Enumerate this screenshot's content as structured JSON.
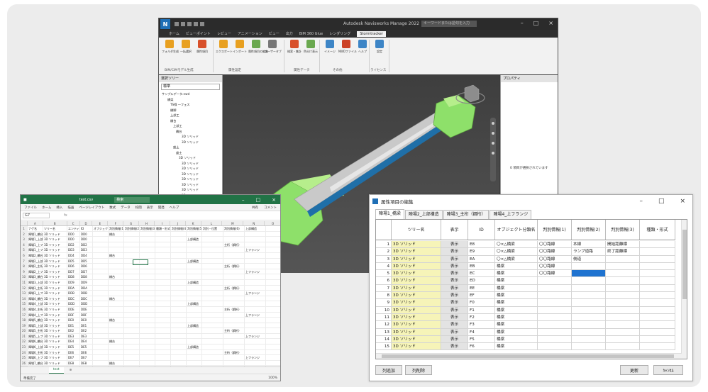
{
  "navisworks": {
    "app_title": "Autodesk Navisworks Manage 2022",
    "search_placeholder": "キーワードまたは語句を入力",
    "ribbon_tabs": [
      "ホーム",
      "ビューポイント",
      "レビュー",
      "アニメーション",
      "ビュー",
      "出力",
      "BIM 360 Glue",
      "レンダリング",
      "Stormtracker"
    ],
    "active_tab": "Stormtracker",
    "ribbon_buttons": [
      {
        "label": "フォルダ生成",
        "color": "#e8a020"
      },
      {
        "label": "一括選択",
        "color": "#e8a020"
      },
      {
        "label": "属性項目",
        "color": "#d8502a"
      },
      {
        "label": "エクスポート",
        "color": "#e8a020"
      },
      {
        "label": "インポート",
        "color": "#e8a020"
      },
      {
        "label": "属性項目の編集",
        "color": "#6aa84f"
      },
      {
        "label": "ユーザータブ",
        "color": "#777777"
      },
      {
        "label": "検索・集計",
        "color": "#d8502a"
      },
      {
        "label": "色分け表示",
        "color": "#6aa84f"
      },
      {
        "label": "イメージ",
        "color": "#3d85c6"
      },
      {
        "label": "NWDファイル",
        "color": "#cc4125"
      },
      {
        "label": "ヘルプ",
        "color": "#3d85c6"
      },
      {
        "label": "設定",
        "color": "#3d85c6"
      }
    ],
    "ribbon_groups": [
      "BIM/CIMモデル生成",
      "属性設定",
      "属性データ",
      "その他",
      "ライセンス"
    ],
    "tree_panel_title": "選択ツリー",
    "tree_combo": "標準",
    "tree_items": [
      "サンプルデータ.nwd",
      "橋梁",
      "TS線 一フェス",
      "橋脚",
      "上部工",
      "橋台",
      "上部工",
      "橋台",
      "3D ソリッド",
      "3D ソリッド",
      "盛土",
      "盛土",
      "3D ソリッド",
      "3D ソリッド",
      "3D ソリッド",
      "3D ソリッド",
      "3D ソリッド",
      "3D ソリッド",
      "3D ソリッド",
      "3D ソリッド",
      "3D ソリッド",
      "3D ソリッド",
      "3D ソリッド",
      "3D ソリッド",
      "3D ソリッド",
      "3D ソリッド"
    ],
    "properties_title": "プロパティ",
    "properties_empty": "0 項目が選択されています"
  },
  "excel": {
    "filename": "test.csv",
    "search_placeholder": "検索",
    "tabs": [
      "ファイル",
      "ホーム",
      "挿入",
      "描画",
      "ページレイアウト",
      "数式",
      "データ",
      "校閲",
      "表示",
      "開発",
      "ヘルプ"
    ],
    "share_label": "共有",
    "comment_label": "コメント",
    "name_box": "G7",
    "columns": [
      "A",
      "B",
      "C",
      "D",
      "E",
      "F",
      "G",
      "H",
      "I",
      "J",
      "K",
      "L",
      "M",
      "N",
      "O"
    ],
    "header_row": [
      "ナゲ名",
      "ツリー名",
      "エンティティ",
      "ID",
      "オブジェクト分類名",
      "判別情報(1)",
      "判別情報(2)",
      "判別情報(3)",
      "種類・形式",
      "判別情報(4)",
      "判別情報(5)",
      "判別・位置",
      "判別情報(6)",
      "上部構造"
    ],
    "rows": [
      [
        "陣場1_橋台",
        "3D ソリッド",
        "DD0",
        "DD0",
        "",
        "橋台",
        "",
        "",
        "",
        "",
        "",
        "",
        "",
        ""
      ],
      [
        "陣場1_上部工",
        "3D ソリッド",
        "DD0",
        "DD0",
        "",
        "",
        "",
        "",
        "",
        "",
        "上部構造",
        "",
        "",
        ""
      ],
      [
        "陣場1_上フランジ",
        "3D ソリッド",
        "DD2",
        "DD2",
        "",
        "",
        "",
        "",
        "",
        "",
        "",
        "",
        "主桁（鋼桁）",
        ""
      ],
      [
        "陣場1_上フランジ",
        "3D ソリッド",
        "DD3",
        "DD3",
        "",
        "",
        "",
        "",
        "",
        "",
        "",
        "",
        "",
        "上フランジ"
      ],
      [
        "陣場2_橋台",
        "3D ソリッド",
        "DD4",
        "DD4",
        "",
        "橋台",
        "",
        "",
        "",
        "",
        "",
        "",
        "",
        ""
      ],
      [
        "陣場2_上部工",
        "3D ソリッド",
        "DD5",
        "DD5",
        "",
        "",
        "",
        "",
        "",
        "",
        "上部構造",
        "",
        "",
        ""
      ],
      [
        "陣場2_主桁",
        "3D ソリッド",
        "DD6",
        "DD6",
        "",
        "",
        "",
        "",
        "",
        "",
        "",
        "",
        "主桁（鋼桁）",
        ""
      ],
      [
        "陣場2_上フランジ",
        "3D ソリッド",
        "DD7",
        "DD7",
        "",
        "",
        "",
        "",
        "",
        "",
        "",
        "",
        "",
        "上フランジ"
      ],
      [
        "陣場3_橋台",
        "3D ソリッド",
        "DD8",
        "DD8",
        "",
        "橋台",
        "",
        "",
        "",
        "",
        "",
        "",
        "",
        ""
      ],
      [
        "陣場3_上部工",
        "3D ソリッド",
        "DD9",
        "DD9",
        "",
        "",
        "",
        "",
        "",
        "",
        "上部構造",
        "",
        "",
        ""
      ],
      [
        "陣場3_主桁",
        "3D ソリッド",
        "DDA",
        "DDA",
        "",
        "",
        "",
        "",
        "",
        "",
        "",
        "",
        "主桁（鋼桁）",
        ""
      ],
      [
        "陣場3_上フランジ",
        "3D ソリッド",
        "DDB",
        "DDB",
        "",
        "",
        "",
        "",
        "",
        "",
        "",
        "",
        "",
        "上フランジ"
      ],
      [
        "陣場4_橋台",
        "3D ソリッド",
        "DDC",
        "DDC",
        "",
        "橋台",
        "",
        "",
        "",
        "",
        "",
        "",
        "",
        ""
      ],
      [
        "陣場4_上部工",
        "3D ソリッド",
        "DDD",
        "DDD",
        "",
        "",
        "",
        "",
        "",
        "",
        "上部構造",
        "",
        "",
        ""
      ],
      [
        "陣場4_主桁",
        "3D ソリッド",
        "DDE",
        "DDE",
        "",
        "",
        "",
        "",
        "",
        "",
        "",
        "",
        "主桁（鋼桁）",
        ""
      ],
      [
        "陣場4_上フランジ",
        "3D ソリッド",
        "DDF",
        "DDF",
        "",
        "",
        "",
        "",
        "",
        "",
        "",
        "",
        "",
        "上フランジ"
      ],
      [
        "陣場5_橋台",
        "3D ソリッド",
        "DE0",
        "DE0",
        "",
        "橋台",
        "",
        "",
        "",
        "",
        "",
        "",
        "",
        ""
      ],
      [
        "陣場5_上部工",
        "3D ソリッド",
        "DE1",
        "DE1",
        "",
        "",
        "",
        "",
        "",
        "",
        "上部構造",
        "",
        "",
        ""
      ],
      [
        "陣場5_主桁",
        "3D ソリッド",
        "DE2",
        "DE2",
        "",
        "",
        "",
        "",
        "",
        "",
        "",
        "",
        "主桁（鋼桁）",
        ""
      ],
      [
        "陣場5_上フランジ",
        "3D ソリッド",
        "DE3",
        "DE3",
        "",
        "",
        "",
        "",
        "",
        "",
        "",
        "",
        "",
        "上フランジ"
      ],
      [
        "陣場6_橋台",
        "3D ソリッド",
        "DE4",
        "DE4",
        "",
        "橋台",
        "",
        "",
        "",
        "",
        "",
        "",
        "",
        ""
      ],
      [
        "陣場6_上部工",
        "3D ソリッド",
        "DE5",
        "DE5",
        "",
        "",
        "",
        "",
        "",
        "",
        "上部構造",
        "",
        "",
        ""
      ],
      [
        "陣場6_主桁",
        "3D ソリッド",
        "DE6",
        "DE6",
        "",
        "",
        "",
        "",
        "",
        "",
        "",
        "",
        "主桁（鋼桁）",
        ""
      ],
      [
        "陣場6_上フランジ",
        "3D ソリッド",
        "DE7",
        "DE7",
        "",
        "",
        "",
        "",
        "",
        "",
        "",
        "",
        "",
        "上フランジ"
      ],
      [
        "陣場7_橋台",
        "3D ソリッド",
        "DE8",
        "DE8",
        "",
        "橋台",
        "",
        "",
        "",
        "",
        "",
        "",
        "",
        ""
      ],
      [
        "陣場7_上部工",
        "3D ソリッド",
        "DE9",
        "DE9",
        "",
        "",
        "",
        "",
        "",
        "",
        "上部構造",
        "",
        "",
        ""
      ],
      [
        "陣場7_主桁",
        "3D ソリッド",
        "DEA",
        "DEA",
        "",
        "",
        "",
        "",
        "",
        "",
        "",
        "",
        "主桁（鋼桁）",
        ""
      ]
    ],
    "sheet_tab": "test",
    "status_left": "準備完了",
    "zoom": "100%"
  },
  "dialog": {
    "title": "属性項目の編集",
    "tabs": [
      "陣場1_橋梁",
      "陣場2_上部構造",
      "陣場3_主桁（鋼桁）",
      "陣場4_上フランジ"
    ],
    "active_tab": 0,
    "columns": [
      "ツリー名",
      "表示",
      "ID",
      "オブジェクト分類名",
      "判別情報(1)",
      "判別情報(2)",
      "判別情報(3)",
      "種類・形式"
    ],
    "rows": [
      {
        "n": "1",
        "name": "3D ソリッド",
        "disp": "表示",
        "id": "E8",
        "cls": "〇×△橋梁",
        "c1": "〇〇路線",
        "c2": "本線",
        "c3": "開始距離標",
        "c4": ""
      },
      {
        "n": "2",
        "name": "3D ソリッド",
        "disp": "表示",
        "id": "E9",
        "cls": "〇×△橋梁",
        "c1": "〇〇路線",
        "c2": "ランプ道路",
        "c3": "終了距離標",
        "c4": ""
      },
      {
        "n": "3",
        "name": "3D ソリッド",
        "disp": "表示",
        "id": "EA",
        "cls": "〇×△橋梁",
        "c1": "〇〇路線",
        "c2": "側道",
        "c3": "",
        "c4": ""
      },
      {
        "n": "4",
        "name": "3D ソリッド",
        "disp": "表示",
        "id": "EB",
        "cls": "橋梁",
        "c1": "〇〇路線",
        "c2": "",
        "c3": "",
        "c4": ""
      },
      {
        "n": "5",
        "name": "3D ソリッド",
        "disp": "表示",
        "id": "EC",
        "cls": "橋梁",
        "c1": "〇〇路線",
        "c2": "",
        "c3": "",
        "c4": ""
      },
      {
        "n": "6",
        "name": "3D ソリッド",
        "disp": "表示",
        "id": "ED",
        "cls": "橋梁",
        "c1": "",
        "c2": "",
        "c3": "",
        "c4": ""
      },
      {
        "n": "7",
        "name": "3D ソリッド",
        "disp": "表示",
        "id": "EE",
        "cls": "橋梁",
        "c1": "",
        "c2": "",
        "c3": "",
        "c4": ""
      },
      {
        "n": "8",
        "name": "3D ソリッド",
        "disp": "表示",
        "id": "EF",
        "cls": "橋梁",
        "c1": "",
        "c2": "",
        "c3": "",
        "c4": ""
      },
      {
        "n": "9",
        "name": "3D ソリッド",
        "disp": "表示",
        "id": "F0",
        "cls": "橋梁",
        "c1": "",
        "c2": "",
        "c3": "",
        "c4": ""
      },
      {
        "n": "10",
        "name": "3D ソリッド",
        "disp": "表示",
        "id": "F1",
        "cls": "橋梁",
        "c1": "",
        "c2": "",
        "c3": "",
        "c4": ""
      },
      {
        "n": "11",
        "name": "3D ソリッド",
        "disp": "表示",
        "id": "F2",
        "cls": "橋梁",
        "c1": "",
        "c2": "",
        "c3": "",
        "c4": ""
      },
      {
        "n": "12",
        "name": "3D ソリッド",
        "disp": "表示",
        "id": "F3",
        "cls": "橋梁",
        "c1": "",
        "c2": "",
        "c3": "",
        "c4": ""
      },
      {
        "n": "13",
        "name": "3D ソリッド",
        "disp": "表示",
        "id": "F4",
        "cls": "橋梁",
        "c1": "",
        "c2": "",
        "c3": "",
        "c4": ""
      },
      {
        "n": "14",
        "name": "3D ソリッド",
        "disp": "表示",
        "id": "F5",
        "cls": "橋梁",
        "c1": "",
        "c2": "",
        "c3": "",
        "c4": ""
      },
      {
        "n": "15",
        "name": "3D ソリッド",
        "disp": "表示",
        "id": "F6",
        "cls": "橋梁",
        "c1": "",
        "c2": "",
        "c3": "",
        "c4": ""
      }
    ],
    "buttons": {
      "add_col": "列追加",
      "del_col": "列削除",
      "update": "更新",
      "cancel": "ｷｬﾝｾﾙ"
    },
    "accent": "#1f73d0",
    "name_cell_color": "#f6f4b8"
  }
}
